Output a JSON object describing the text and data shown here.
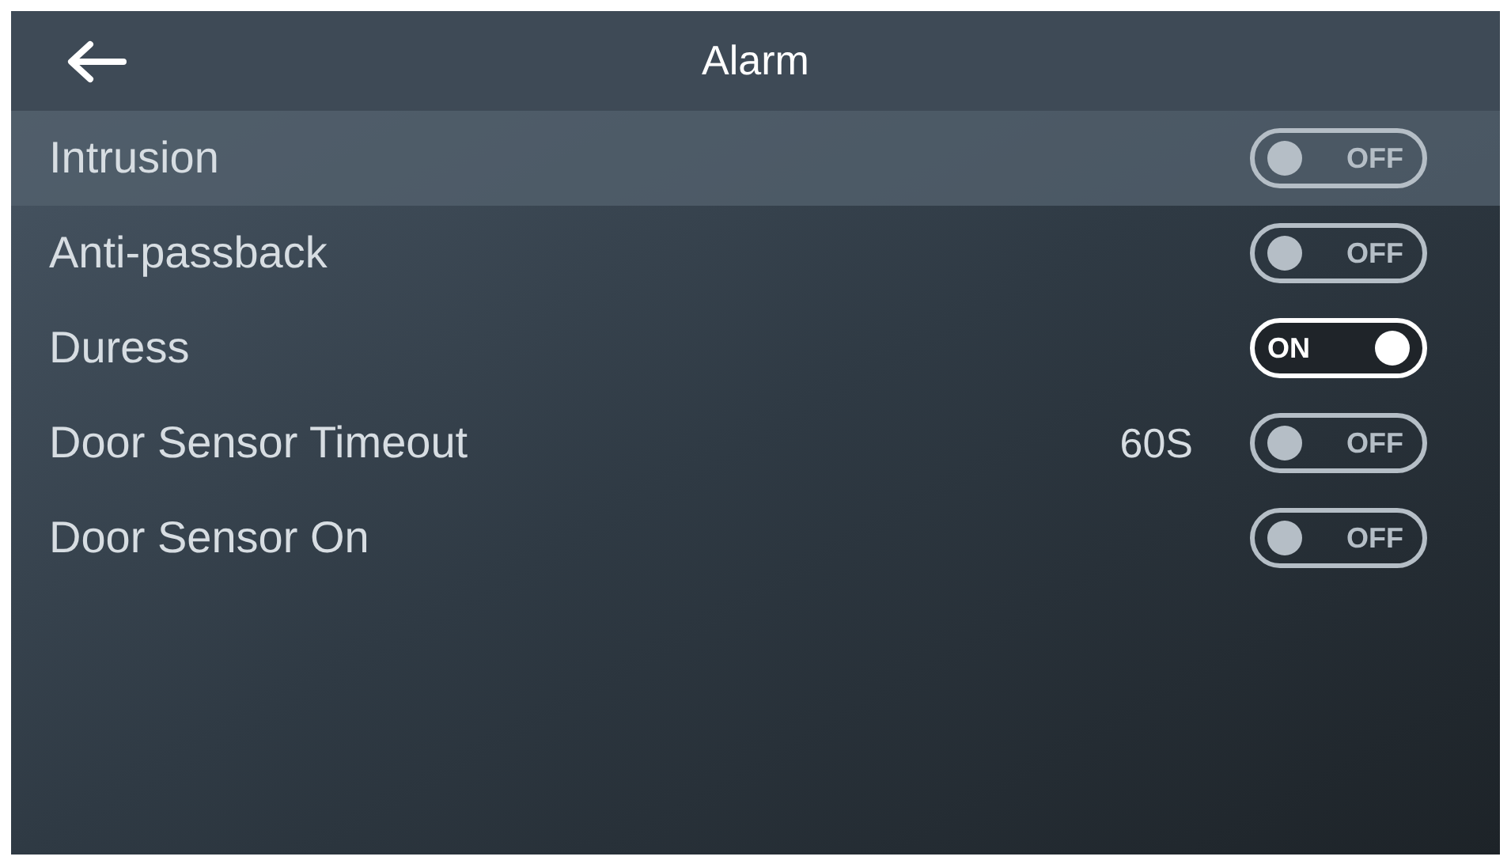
{
  "header": {
    "title": "Alarm"
  },
  "settings": [
    {
      "label": "Intrusion",
      "selected": true,
      "on": false,
      "toggle_text": "OFF"
    },
    {
      "label": "Anti-passback",
      "selected": false,
      "on": false,
      "toggle_text": "OFF"
    },
    {
      "label": "Duress",
      "selected": false,
      "on": true,
      "toggle_text": "ON"
    },
    {
      "label": "Door Sensor Timeout",
      "selected": false,
      "on": false,
      "toggle_text": "OFF",
      "value": "60S"
    },
    {
      "label": "Door Sensor On",
      "selected": false,
      "on": false,
      "toggle_text": "OFF"
    }
  ]
}
